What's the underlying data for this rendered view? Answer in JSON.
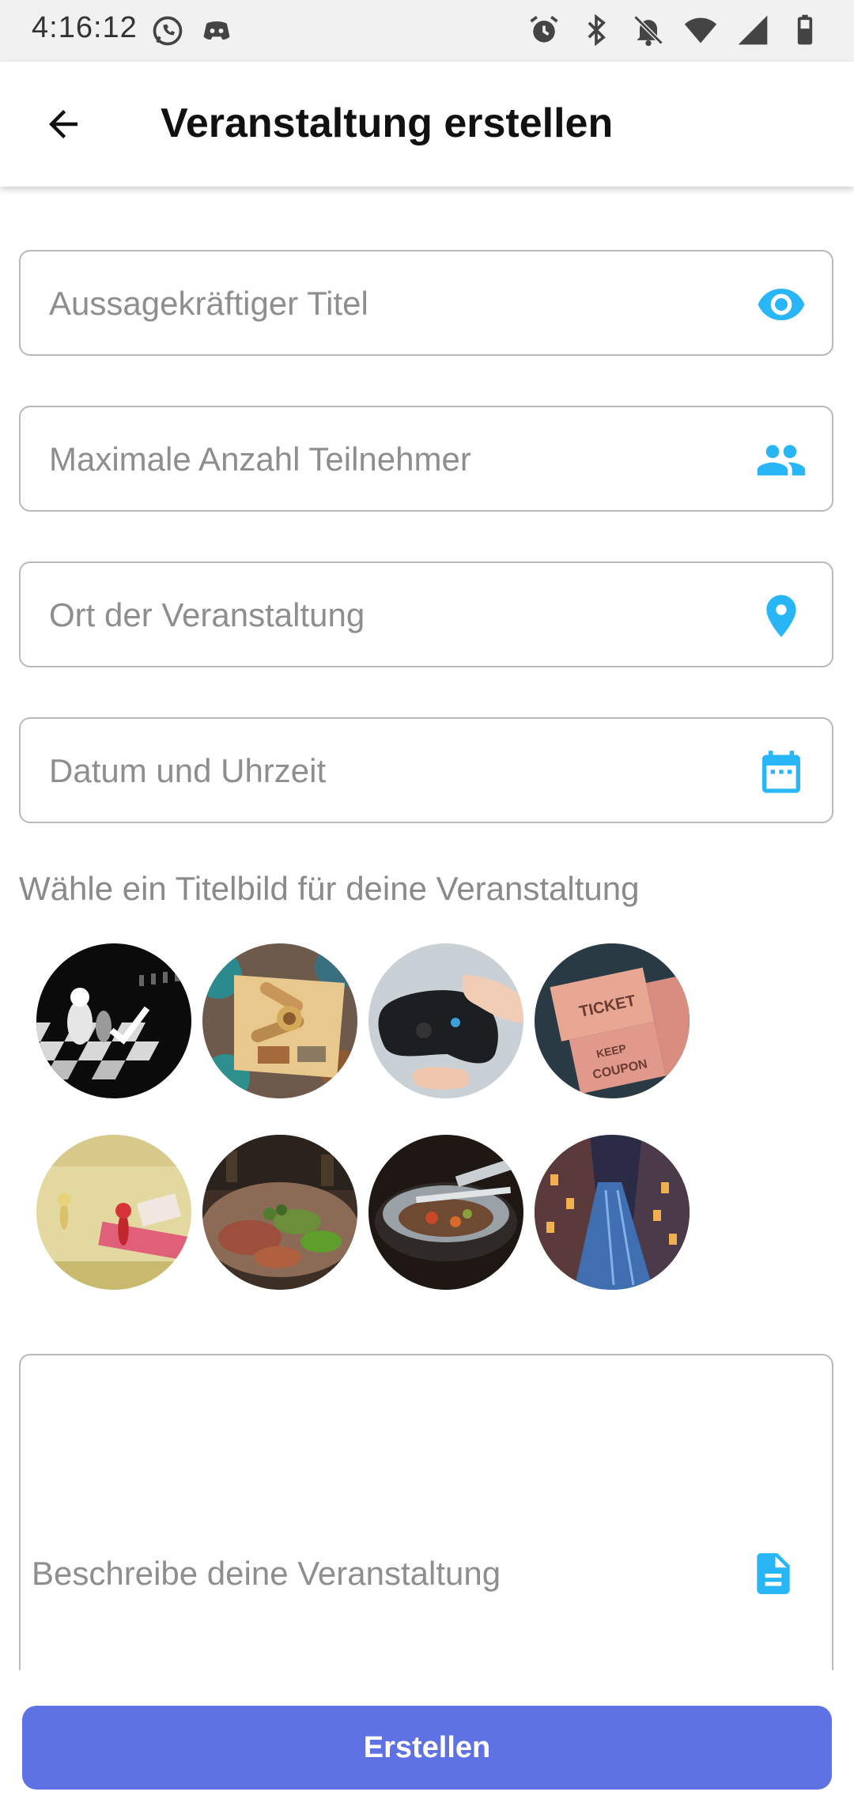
{
  "status_bar": {
    "time": "4:16:12",
    "left_icons": [
      "whatsapp-icon",
      "discord-icon"
    ],
    "right_icons": [
      "alarm-icon",
      "bluetooth-icon",
      "notifications-off-icon",
      "wifi-icon",
      "signal-icon",
      "battery-icon"
    ]
  },
  "app_bar": {
    "title": "Veranstaltung erstellen",
    "back_icon": "arrow-back-icon"
  },
  "form": {
    "title_field": {
      "value": "",
      "placeholder": "Aussagekräftiger Titel",
      "icon": "eye-icon"
    },
    "participants_field": {
      "value": "",
      "placeholder": "Maximale Anzahl Teilnehmer",
      "icon": "people-icon"
    },
    "location_field": {
      "value": "",
      "placeholder": "Ort der Veranstaltung",
      "icon": "location-pin-icon"
    },
    "datetime_field": {
      "value": "",
      "placeholder": "Datum und Uhrzeit",
      "icon": "calendar-icon"
    },
    "cover_label": "Wähle ein Titelbild für deine Veranstaltung",
    "cover_images": [
      {
        "name": "chess",
        "selected": true
      },
      {
        "name": "food-platter"
      },
      {
        "name": "game-controller"
      },
      {
        "name": "tickets"
      },
      {
        "name": "board-game"
      },
      {
        "name": "grilled-meat"
      },
      {
        "name": "wok-cooking"
      },
      {
        "name": "rainy-street"
      }
    ],
    "description_field": {
      "value": "",
      "placeholder": "Beschreibe deine Veranstaltung",
      "icon": "document-icon"
    }
  },
  "submit_label": "Erstellen",
  "colors": {
    "accent": "#29b6f6",
    "button": "#5f72e3",
    "border": "#b9b9b9"
  }
}
